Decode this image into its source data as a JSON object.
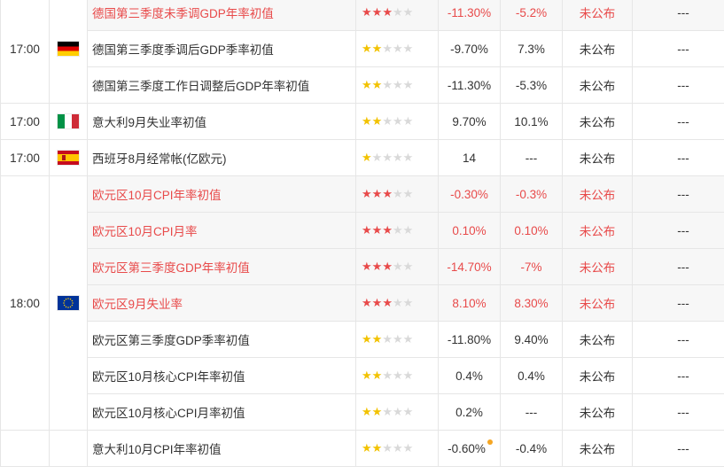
{
  "colors": {
    "highlight": "#e84a4a",
    "star_red": "#e84a4a",
    "star_yellow": "#f2c200",
    "star_grey": "#d9d9d9",
    "row_highlight_bg": "#f7f7f7"
  },
  "groups": [
    {
      "time": "17:00",
      "flag_icon": "germany-flag-icon",
      "rows": [
        {
          "name": "德国第三季度未季调GDP年率初值",
          "stars": 3,
          "prev": "-11.30%",
          "forecast": "-5.2%",
          "actual": "未公布",
          "last": "---",
          "highlight": true
        },
        {
          "name": "德国第三季度季调后GDP季率初值",
          "stars": 2,
          "prev": "-9.70%",
          "forecast": "7.3%",
          "actual": "未公布",
          "last": "---",
          "highlight": false
        },
        {
          "name": "德国第三季度工作日调整后GDP年率初值",
          "stars": 2,
          "prev": "-11.30%",
          "forecast": "-5.3%",
          "actual": "未公布",
          "last": "---",
          "highlight": false
        }
      ]
    },
    {
      "time": "17:00",
      "flag_icon": "italy-flag-icon",
      "rows": [
        {
          "name": "意大利9月失业率初值",
          "stars": 2,
          "prev": "9.70%",
          "forecast": "10.1%",
          "actual": "未公布",
          "last": "---",
          "highlight": false
        }
      ]
    },
    {
      "time": "17:00",
      "flag_icon": "spain-flag-icon",
      "rows": [
        {
          "name": "西班牙8月经常帐(亿欧元)",
          "stars": 1,
          "prev": "14",
          "forecast": "---",
          "actual": "未公布",
          "last": "---",
          "highlight": false
        }
      ]
    },
    {
      "time": "18:00",
      "flag_icon": "eu-flag-icon",
      "rows": [
        {
          "name": "欧元区10月CPI年率初值",
          "stars": 3,
          "prev": "-0.30%",
          "forecast": "-0.3%",
          "actual": "未公布",
          "last": "---",
          "highlight": true
        },
        {
          "name": "欧元区10月CPI月率",
          "stars": 3,
          "prev": "0.10%",
          "forecast": "0.10%",
          "actual": "未公布",
          "last": "---",
          "highlight": true
        },
        {
          "name": "欧元区第三季度GDP年率初值",
          "stars": 3,
          "prev": "-14.70%",
          "forecast": "-7%",
          "actual": "未公布",
          "last": "---",
          "highlight": true
        },
        {
          "name": "欧元区9月失业率",
          "stars": 3,
          "prev": "8.10%",
          "forecast": "8.30%",
          "actual": "未公布",
          "last": "---",
          "highlight": true
        },
        {
          "name": "欧元区第三季度GDP季率初值",
          "stars": 2,
          "prev": "-11.80%",
          "forecast": "9.40%",
          "actual": "未公布",
          "last": "---",
          "highlight": false
        },
        {
          "name": "欧元区10月核心CPI年率初值",
          "stars": 2,
          "prev": "0.4%",
          "forecast": "0.4%",
          "actual": "未公布",
          "last": "---",
          "highlight": false
        },
        {
          "name": "欧元区10月核心CPI月率初值",
          "stars": 2,
          "prev": "0.2%",
          "forecast": "---",
          "actual": "未公布",
          "last": "---",
          "highlight": false
        }
      ]
    },
    {
      "time": "",
      "flag_icon": "",
      "rows": [
        {
          "name": "意大利10月CPI年率初值",
          "stars": 2,
          "prev": "-0.60%",
          "prev_dot": true,
          "forecast": "-0.4%",
          "actual": "未公布",
          "last": "---",
          "highlight": false
        }
      ]
    }
  ]
}
